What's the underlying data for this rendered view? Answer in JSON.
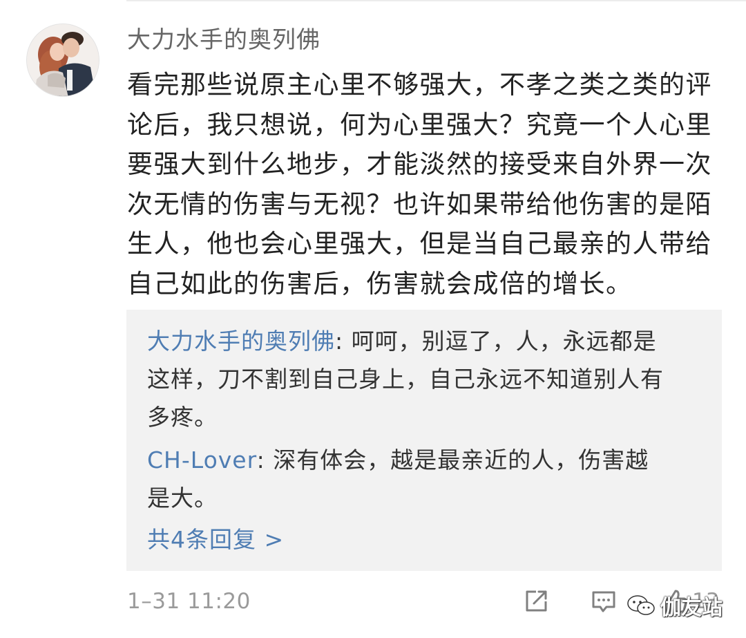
{
  "comment": {
    "username": "大力水手的奥列佛",
    "text": "看完那些说原主心里不够强大，不孝之类之类的评\n论后，我只想说，何为心里强大？究竟一个人心里\n要强大到什么地步，才能淡然的接受来自外界一次\n次无情的伤害与无视？也许如果带给他伤害的是陌\n生人，他也会心里强大，但是当自己最亲的人带给\n自己如此的伤害后，伤害就会成倍的增长。",
    "timestamp": "1–31 11:20",
    "like_count": "13"
  },
  "replies": [
    {
      "author": "大力水手的奥列佛",
      "text": ": 呵呵，别逗了，人，永远都是\n这样，刀不割到自己身上，自己永远不知道别人有\n多疼。"
    },
    {
      "author": "CH-Lover",
      "text": ": 深有体会，越是最亲近的人，伤害越\n是大。"
    }
  ],
  "more_replies_label": "共4条回复 >",
  "watermark": {
    "text": "伽友站"
  },
  "icons": {
    "share": "edit-share-icon",
    "comment": "comment-icon",
    "like": "thumbs-up-icon",
    "watermark": "wechat-logo-icon"
  },
  "colors": {
    "link": "#4f7db3",
    "reply_bg": "#f2f2f2",
    "meta_text": "#9a9a9a"
  }
}
